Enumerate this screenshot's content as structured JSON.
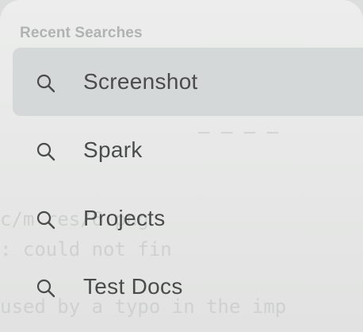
{
  "recent_searches": {
    "title": "Recent Searches",
    "items": [
      {
        "label": "Screenshot",
        "icon": "search-icon",
        "selected": true
      },
      {
        "label": "Spark",
        "icon": "search-icon",
        "selected": false
      },
      {
        "label": "Projects",
        "icon": "search-icon",
        "selected": false
      },
      {
        "label": "Test Docs",
        "icon": "search-icon",
        "selected": false
      }
    ]
  },
  "colors": {
    "panel_background": "#e9eae9",
    "selected_row": "#d5d8d8",
    "text": "#4a4c4c",
    "section_title": "#b1b3b3"
  }
}
